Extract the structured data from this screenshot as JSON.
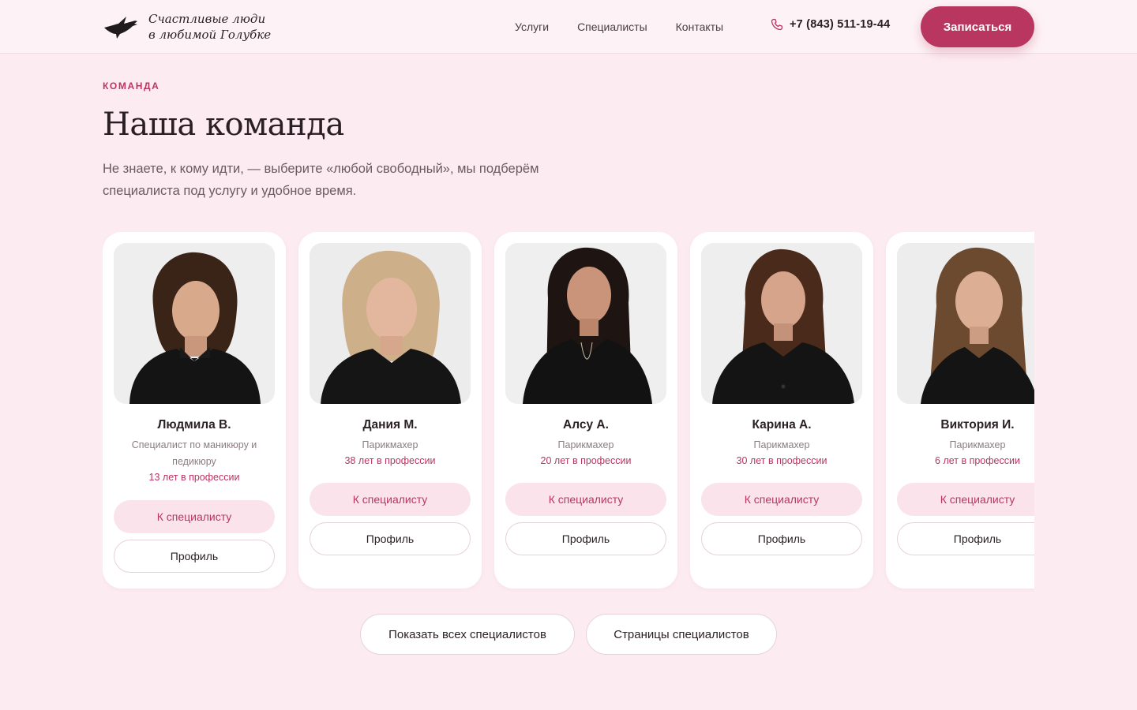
{
  "header": {
    "logo_line1": "Счастливые люди",
    "logo_line2": "в любимой Голубке",
    "nav": [
      "Услуги",
      "Специалисты",
      "Контакты"
    ],
    "phone": "+7 (843) 511-19-44",
    "cta": "Записаться"
  },
  "section": {
    "eyebrow": "КОМАНДА",
    "title": "Наша команда",
    "subtitle": "Не знаете, к кому идти, — выберите «любой свободный», мы подберём специалиста под услугу и удобное время."
  },
  "specialists": [
    {
      "name": "Людмила В.",
      "role": "Специалист по маникюру и педикюру",
      "experience": "13 лет в профессии",
      "to_specialist": "К специалисту",
      "profile": "Профиль"
    },
    {
      "name": "Дания М.",
      "role": "Парикмахер",
      "experience": "38 лет в профессии",
      "to_specialist": "К специалисту",
      "profile": "Профиль"
    },
    {
      "name": "Алсу А.",
      "role": "Парикмахер",
      "experience": "20 лет в профессии",
      "to_specialist": "К специалисту",
      "profile": "Профиль"
    },
    {
      "name": "Карина А.",
      "role": "Парикмахер",
      "experience": "30 лет в профессии",
      "to_specialist": "К специалисту",
      "profile": "Профиль"
    },
    {
      "name": "Виктория И.",
      "role": "Парикмахер",
      "experience": "6 лет в профессии",
      "to_specialist": "К специалисту",
      "profile": "Профиль"
    }
  ],
  "bottom": {
    "show_all": "Показать всех специалистов",
    "pages": "Страницы специалистов"
  },
  "colors": {
    "accent": "#b8365f",
    "background": "#fcecf1",
    "pill": "#fae3eb"
  },
  "icons": {
    "logo": "dove-logo-icon",
    "phone": "phone-icon"
  }
}
